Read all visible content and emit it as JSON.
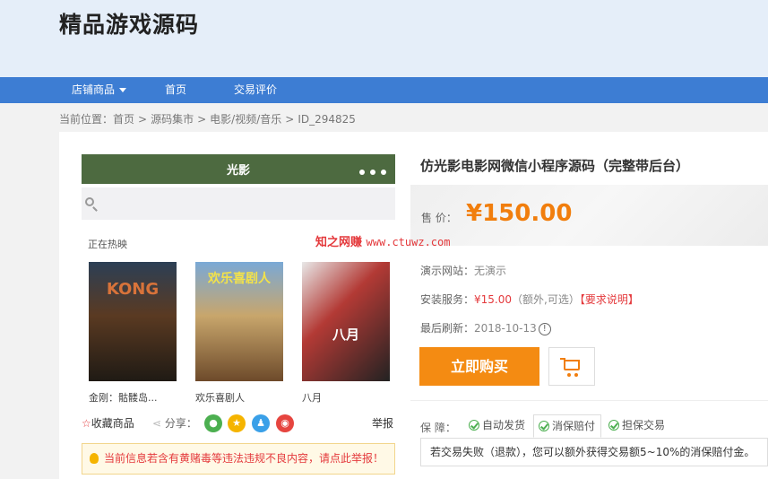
{
  "site": {
    "title": "精品游戏源码"
  },
  "nav": {
    "items": [
      "店铺商品",
      "首页",
      "交易评价"
    ]
  },
  "breadcrumb": {
    "prefix": "当前位置：",
    "items": [
      "首页",
      "源码集市",
      "电影/视频/音乐",
      "ID_294825"
    ],
    "separator": ">"
  },
  "preview": {
    "app_title": "光影",
    "section_title": "正在热映",
    "posters": [
      {
        "text": "KONG",
        "name": "金刚：骷髅岛..."
      },
      {
        "text": "欢乐喜剧人",
        "name": "欢乐喜剧人"
      },
      {
        "text": "八月",
        "name": "八月"
      }
    ]
  },
  "actions": {
    "favorite": "收藏商品",
    "share": "分享：",
    "report": "举报"
  },
  "tip": {
    "text": "当前信息若含有黄赌毒等违法违规不良内容，请点此举报！"
  },
  "product": {
    "title": "仿光影电影网微信小程序源码（完整带后台）",
    "price_label": "售  价：",
    "price": "¥150.00",
    "demo_label": "演示网站：",
    "demo_value": "无演示",
    "install_label": "安装服务：",
    "install_price": "¥15.00",
    "install_note": "（额外,可选）",
    "install_link": "【要求说明】",
    "refresh_label": "最后刷新：",
    "refresh_value": "2018-10-13",
    "buy_label": "立即购买"
  },
  "watermark": {
    "cn": "知之网赚",
    "url": "www.ctuwz.com"
  },
  "guarantee": {
    "label": "保  障：",
    "items": [
      "自动发货",
      "消保赔付",
      "担保交易"
    ],
    "desc": "若交易失败（退款），您可以额外获得交易额5~10%的消保赔付金。"
  },
  "colors": {
    "nav": "#3d7dd3",
    "price": "#f17e0d",
    "buy": "#f48b12",
    "header": "#e5eef9"
  }
}
